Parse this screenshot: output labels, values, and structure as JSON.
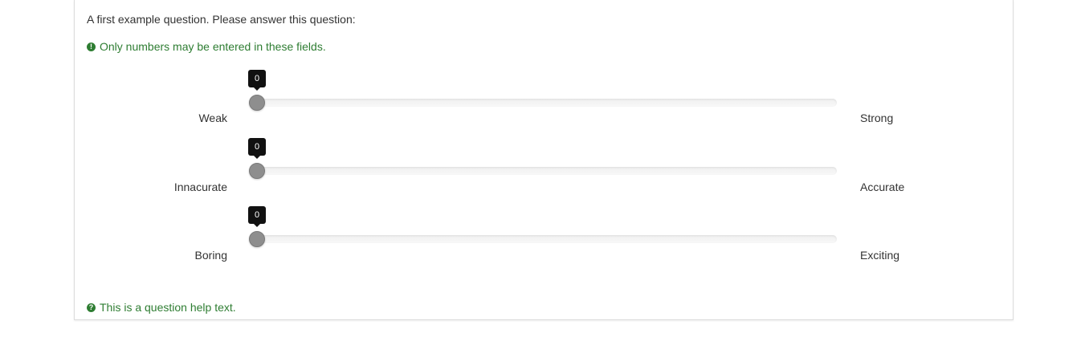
{
  "question": {
    "text": "A first example question. Please answer this question:",
    "validation_tip": "Only numbers may be entered in these fields.",
    "help_text": "This is a question help text."
  },
  "icons": {
    "validation": "exclamation-circle-icon",
    "help": "question-circle-icon"
  },
  "colors": {
    "tip_green": "#2e7d32",
    "handle": "#8e8e8e",
    "tooltip_bg": "#111111"
  },
  "sliders": [
    {
      "left_label": "Weak",
      "right_label": "Strong",
      "value": "0",
      "fraction": 0
    },
    {
      "left_label": "Innacurate",
      "right_label": "Accurate",
      "value": "0",
      "fraction": 0
    },
    {
      "left_label": "Boring",
      "right_label": "Exciting",
      "value": "0",
      "fraction": 0
    }
  ]
}
